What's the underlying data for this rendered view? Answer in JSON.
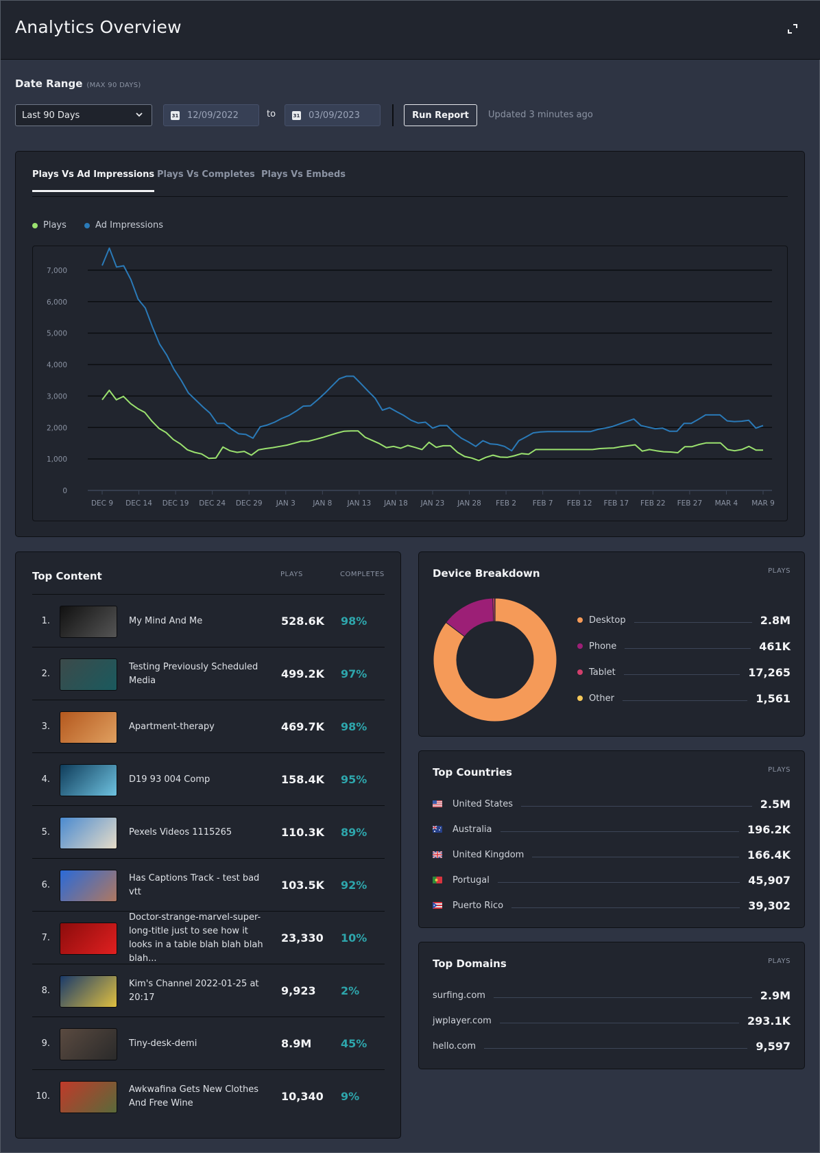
{
  "header": {
    "title": "Analytics Overview",
    "expand_icon": "expand-icon"
  },
  "date_range": {
    "label": "Date Range",
    "sublabel": "(MAX 90 DAYS)",
    "preset": "Last 90 Days",
    "start_date": "12/09/2022",
    "to_label": "to",
    "end_date": "03/09/2023",
    "run_button": "Run Report",
    "updated_text": "Updated 3 minutes ago",
    "calendar_glyph": "31"
  },
  "chart_panel": {
    "tabs": [
      {
        "label": "Plays Vs Ad Impressions",
        "active": true
      },
      {
        "label": "Plays Vs Completes",
        "active": false
      },
      {
        "label": "Plays Vs Embeds",
        "active": false
      }
    ]
  },
  "chart_data": {
    "type": "line",
    "title": "Plays Vs Ad Impressions",
    "xlabel": "",
    "ylabel": "",
    "ylim": [
      0,
      7500
    ],
    "yticks": [
      0,
      1000,
      2000,
      3000,
      4000,
      5000,
      6000,
      7000
    ],
    "ytick_labels": [
      "0",
      "1,000",
      "2,000",
      "3,000",
      "4,000",
      "5,000",
      "6,000",
      "7,000"
    ],
    "xtick_labels": [
      "DEC 9",
      "DEC 14",
      "DEC 19",
      "DEC 24",
      "DEC 29",
      "JAN 3",
      "JAN 8",
      "JAN 13",
      "JAN 18",
      "JAN 23",
      "JAN 28",
      "FEB 2",
      "FEB 7",
      "FEB 12",
      "FEB 17",
      "FEB 22",
      "FEB 27",
      "MAR 4",
      "MAR 9"
    ],
    "x_start": "Dec 9, 2022",
    "x_end": "Mar 9, 2023",
    "grid": true,
    "legend_position": "top-left",
    "series": [
      {
        "name": "Plays",
        "color": "#9be26f",
        "values": [
          2880,
          3180,
          2880,
          2990,
          2760,
          2600,
          2480,
          2200,
          1970,
          1840,
          1620,
          1480,
          1290,
          1210,
          1160,
          1020,
          1030,
          1380,
          1260,
          1210,
          1240,
          1120,
          1290,
          1330,
          1360,
          1400,
          1440,
          1500,
          1560,
          1560,
          1620,
          1680,
          1750,
          1820,
          1880,
          1890,
          1890,
          1690,
          1590,
          1490,
          1360,
          1400,
          1340,
          1430,
          1370,
          1300,
          1530,
          1370,
          1420,
          1420,
          1210,
          1080,
          1030,
          950,
          1050,
          1120,
          1060,
          1050,
          1100,
          1170,
          1150,
          1300,
          1300,
          1300,
          1300,
          1300,
          1300,
          1300,
          1300,
          1300,
          1330,
          1340,
          1350,
          1390,
          1420,
          1450,
          1250,
          1300,
          1260,
          1230,
          1220,
          1200,
          1390,
          1390,
          1460,
          1510,
          1510,
          1510,
          1300,
          1260,
          1300,
          1400,
          1280,
          1280
        ],
        "sample_every_days": 1
      },
      {
        "name": "Ad Impressions",
        "color": "#2a7ab8",
        "values": [
          7150,
          7700,
          7100,
          7140,
          6700,
          6080,
          5800,
          5200,
          4650,
          4300,
          3850,
          3500,
          3100,
          2880,
          2660,
          2460,
          2130,
          2130,
          1950,
          1800,
          1780,
          1660,
          2020,
          2080,
          2170,
          2290,
          2380,
          2520,
          2680,
          2690,
          2880,
          3090,
          3320,
          3550,
          3630,
          3630,
          3400,
          3160,
          2930,
          2550,
          2630,
          2500,
          2380,
          2230,
          2140,
          2170,
          1980,
          2060,
          2060,
          1840,
          1660,
          1540,
          1400,
          1580,
          1480,
          1460,
          1400,
          1260,
          1580,
          1700,
          1830,
          1860,
          1870,
          1870,
          1870,
          1870,
          1870,
          1870,
          1870,
          1940,
          1980,
          2030,
          2110,
          2190,
          2270,
          2060,
          2010,
          1960,
          1980,
          1880,
          1880,
          2130,
          2130,
          2260,
          2400,
          2400,
          2400,
          2210,
          2190,
          2200,
          2230,
          1980,
          2060
        ],
        "sample_every_days": 1
      }
    ]
  },
  "top_content": {
    "title": "Top Content",
    "col_plays": "PLAYS",
    "col_completes": "COMPLETES",
    "rows": [
      {
        "rank": "1.",
        "title": "My Mind And Me",
        "plays": "528.6K",
        "completes": "98%",
        "thumb_colors": [
          "#111111",
          "#555555"
        ]
      },
      {
        "rank": "2.",
        "title": "Testing Previously Scheduled Media",
        "plays": "499.2K",
        "completes": "97%",
        "thumb_colors": [
          "#3c4a4a",
          "#1a5a5e"
        ]
      },
      {
        "rank": "3.",
        "title": "Apartment-therapy",
        "plays": "469.7K",
        "completes": "98%",
        "thumb_colors": [
          "#b4581e",
          "#e0a060"
        ]
      },
      {
        "rank": "4.",
        "title": "D19 93 004 Comp",
        "plays": "158.4K",
        "completes": "95%",
        "thumb_colors": [
          "#0f3c5a",
          "#6ec2e0"
        ]
      },
      {
        "rank": "5.",
        "title": "Pexels Videos 1115265",
        "plays": "110.3K",
        "completes": "89%",
        "thumb_colors": [
          "#4a8ad0",
          "#e6dcc8"
        ]
      },
      {
        "rank": "6.",
        "title": "Has Captions Track - test bad vtt",
        "plays": "103.5K",
        "completes": "92%",
        "thumb_colors": [
          "#2a6ad8",
          "#b07860"
        ]
      },
      {
        "rank": "7.",
        "title": "Doctor-strange-marvel-super-long-title just to see how it looks in a table blah blah blah blah...",
        "plays": "23,330",
        "completes": "10%",
        "thumb_colors": [
          "#8c0c0c",
          "#e02020"
        ]
      },
      {
        "rank": "8.",
        "title": "Kim's Channel 2022-01-25 at 20:17",
        "plays": "9,923",
        "completes": "2%",
        "thumb_colors": [
          "#1a3a6a",
          "#e0c040"
        ]
      },
      {
        "rank": "9.",
        "title": "Tiny-desk-demi",
        "plays": "8.9M",
        "completes": "45%",
        "thumb_colors": [
          "#5a4a40",
          "#2a2a2a"
        ]
      },
      {
        "rank": "10.",
        "title": "Awkwafina Gets New Clothes And Free Wine",
        "plays": "10,340",
        "completes": "9%",
        "thumb_colors": [
          "#c03a2a",
          "#5a6a3a"
        ]
      }
    ]
  },
  "device_breakdown": {
    "title": "Device Breakdown",
    "col": "PLAYS",
    "items": [
      {
        "label": "Desktop",
        "value": "2.8M",
        "raw": 2800000,
        "color": "#f59a58"
      },
      {
        "label": "Phone",
        "value": "461K",
        "raw": 461000,
        "color": "#9c1f76"
      },
      {
        "label": "Tablet",
        "value": "17,265",
        "raw": 17265,
        "color": "#d23f6c"
      },
      {
        "label": "Other",
        "value": "1,561",
        "raw": 1561,
        "color": "#f5c85a"
      }
    ]
  },
  "top_countries": {
    "title": "Top Countries",
    "col": "PLAYS",
    "items": [
      {
        "label": "United States",
        "value": "2.5M",
        "flag": "us-flag-icon"
      },
      {
        "label": "Australia",
        "value": "196.2K",
        "flag": "au-flag-icon"
      },
      {
        "label": "United Kingdom",
        "value": "166.4K",
        "flag": "gb-flag-icon"
      },
      {
        "label": "Portugal",
        "value": "45,907",
        "flag": "pt-flag-icon"
      },
      {
        "label": "Puerto Rico",
        "value": "39,302",
        "flag": "pr-flag-icon"
      }
    ]
  },
  "top_domains": {
    "title": "Top Domains",
    "col": "PLAYS",
    "items": [
      {
        "label": "surfing.com",
        "value": "2.9M"
      },
      {
        "label": "jwplayer.com",
        "value": "293.1K"
      },
      {
        "label": "hello.com",
        "value": "9,597"
      }
    ]
  }
}
